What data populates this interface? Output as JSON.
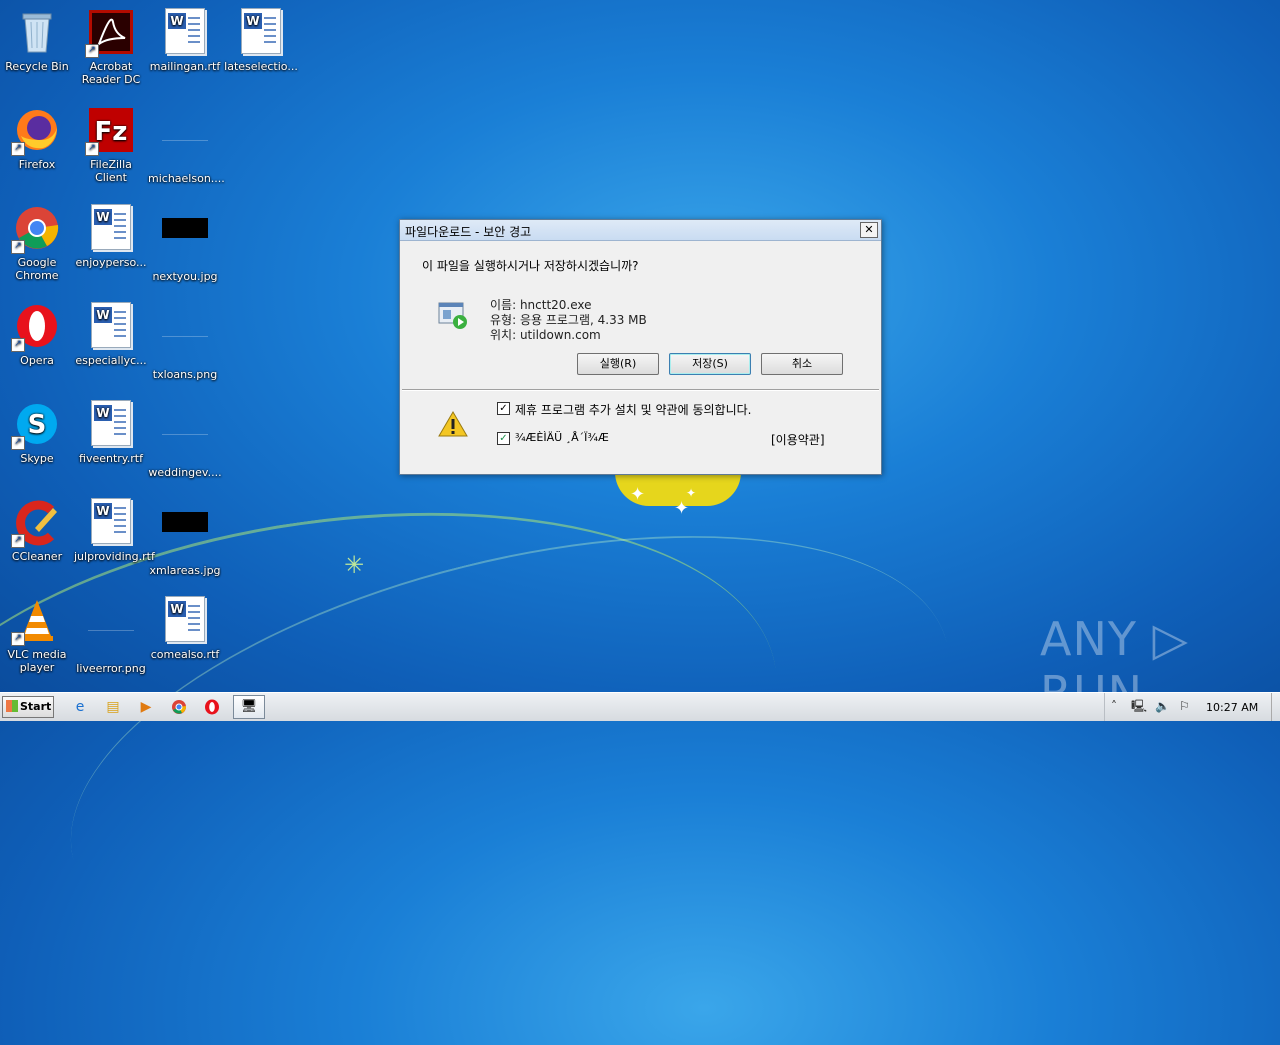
{
  "desktop": {
    "icons": [
      {
        "label": "Recycle Bin",
        "icon": "recycle-bin-icon"
      },
      {
        "label": "Acrobat Reader DC",
        "icon": "acrobat-icon"
      },
      {
        "label": "mailingan.rtf",
        "icon": "word-doc-icon"
      },
      {
        "label": "lateselectio...",
        "icon": "word-doc-icon"
      },
      {
        "label": "Firefox",
        "icon": "firefox-icon"
      },
      {
        "label": "FileZilla Client",
        "icon": "filezilla-icon"
      },
      {
        "label": "michaelson....",
        "icon": "blank-file-icon"
      },
      {
        "label": "Google Chrome",
        "icon": "chrome-icon"
      },
      {
        "label": "enjoyperso...",
        "icon": "word-doc-icon"
      },
      {
        "label": "nextyou.jpg",
        "icon": "image-file-icon"
      },
      {
        "label": "Opera",
        "icon": "opera-icon"
      },
      {
        "label": "especiallyc...",
        "icon": "word-doc-icon"
      },
      {
        "label": "txloans.png",
        "icon": "blank-file-icon"
      },
      {
        "label": "Skype",
        "icon": "skype-icon"
      },
      {
        "label": "fiveentry.rtf",
        "icon": "word-doc-icon"
      },
      {
        "label": "weddingev....",
        "icon": "blank-file-icon"
      },
      {
        "label": "CCleaner",
        "icon": "ccleaner-icon"
      },
      {
        "label": "julproviding.rtf",
        "icon": "word-doc-icon"
      },
      {
        "label": "xmlareas.jpg",
        "icon": "image-file-icon"
      },
      {
        "label": "VLC media player",
        "icon": "vlc-icon"
      },
      {
        "label": "liveerror.png",
        "icon": "blank-file-icon"
      },
      {
        "label": "comealso.rtf",
        "icon": "word-doc-icon"
      }
    ]
  },
  "dialog": {
    "title": "파일다운로드 - 보안 경고",
    "question": "이 파일을 실행하시거나 저장하시겠습니까?",
    "name_line": "이름: hnctt20.exe",
    "type_line": "유형: 응용 프로그램, 4.33 MB",
    "location_line": "위치: utildown.com",
    "buttons": {
      "run": "실행(R)",
      "save": "저장(S)",
      "cancel": "취소"
    },
    "checkbox1_label": "제휴 프로그램 추가 설치 및 약관에 동의합니다.",
    "checkbox2_label": "¾ÆÈÌÄÜ ¸Å´Ï¾Æ",
    "terms_link": "[이용약관]",
    "close_glyph": "✕"
  },
  "taskbar": {
    "start_label": "Start",
    "clock": "10:27 AM"
  },
  "watermark": "ANY ▷ RUN"
}
